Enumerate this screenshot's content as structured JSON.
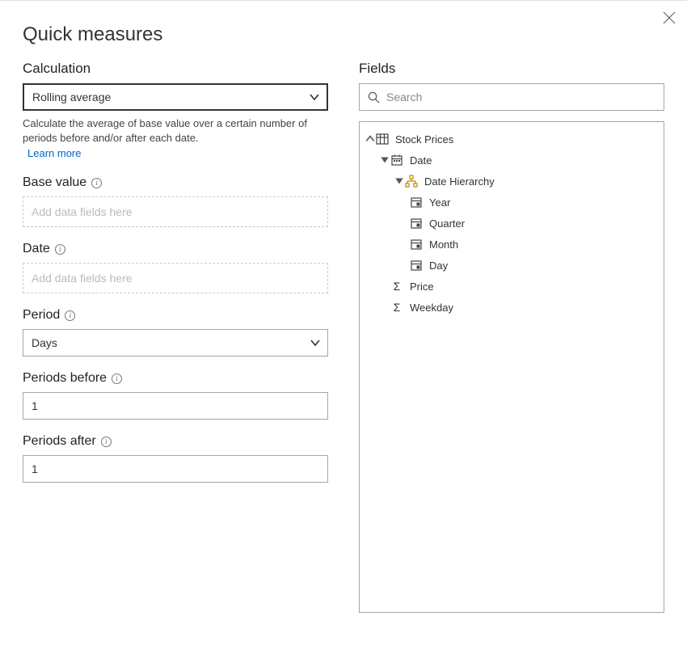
{
  "title": "Quick measures",
  "calculation": {
    "label": "Calculation",
    "selected": "Rolling average",
    "help": "Calculate the average of base value over a certain number of periods before and/or after each date.",
    "learnMore": "Learn more"
  },
  "baseValue": {
    "label": "Base value",
    "placeholder": "Add data fields here"
  },
  "date": {
    "label": "Date",
    "placeholder": "Add data fields here"
  },
  "period": {
    "label": "Period",
    "selected": "Days"
  },
  "periodsBefore": {
    "label": "Periods before",
    "value": "1"
  },
  "periodsAfter": {
    "label": "Periods after",
    "value": "1"
  },
  "fields": {
    "label": "Fields",
    "searchPlaceholder": "Search",
    "tree": {
      "table": "Stock Prices",
      "dateField": "Date",
      "hierarchy": "Date Hierarchy",
      "levels": [
        "Year",
        "Quarter",
        "Month",
        "Day"
      ],
      "measures": [
        "Price",
        "Weekday"
      ]
    }
  }
}
